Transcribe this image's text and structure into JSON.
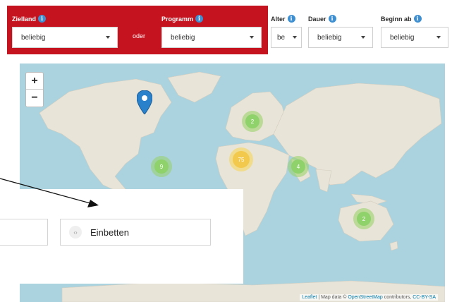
{
  "filters": {
    "zielland": {
      "label": "Zielland",
      "value": "beliebig"
    },
    "or_label": "oder",
    "programm": {
      "label": "Programm",
      "value": "beliebig"
    },
    "alter": {
      "label": "Alter",
      "value": "be"
    },
    "dauer": {
      "label": "Dauer",
      "value": "beliebig"
    },
    "beginn": {
      "label": "Beginn ab",
      "value": "beliebig"
    },
    "info_icon": "i"
  },
  "map": {
    "zoom_in": "+",
    "zoom_out": "−",
    "clusters": [
      {
        "name": "cluster-europe",
        "count": "2",
        "color": "#8fd16a"
      },
      {
        "name": "cluster-america",
        "count": "9",
        "color": "#8fd16a"
      },
      {
        "name": "cluster-africa",
        "count": "75",
        "color": "#f2c94c"
      },
      {
        "name": "cluster-asia",
        "count": "4",
        "color": "#8fd16a"
      },
      {
        "name": "cluster-australia",
        "count": "2",
        "color": "#8fd16a"
      }
    ],
    "attribution": {
      "leaflet": "Leaflet",
      "sep": " | Map data © ",
      "osm": "OpenStreetMap",
      "contrib": " contributors, ",
      "license": "CC-BY-SA"
    }
  },
  "popup": {
    "embed_label": "Einbetten",
    "embed_icon": "‹›"
  },
  "colors": {
    "brand_red": "#c5131f",
    "water": "#aad3df",
    "land": "#e8e4d8",
    "info": "#3d8fd1",
    "marker": "#2a81cb"
  }
}
